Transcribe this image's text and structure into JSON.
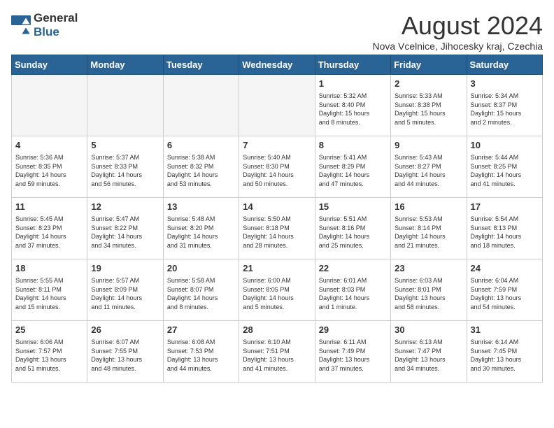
{
  "header": {
    "logo_general": "General",
    "logo_blue": "Blue",
    "title": "August 2024",
    "subtitle": "Nova Vcelnice, Jihocesky kraj, Czechia"
  },
  "weekdays": [
    "Sunday",
    "Monday",
    "Tuesday",
    "Wednesday",
    "Thursday",
    "Friday",
    "Saturday"
  ],
  "weeks": [
    [
      {
        "num": "",
        "info": ""
      },
      {
        "num": "",
        "info": ""
      },
      {
        "num": "",
        "info": ""
      },
      {
        "num": "",
        "info": ""
      },
      {
        "num": "1",
        "info": "Sunrise: 5:32 AM\nSunset: 8:40 PM\nDaylight: 15 hours\nand 8 minutes."
      },
      {
        "num": "2",
        "info": "Sunrise: 5:33 AM\nSunset: 8:38 PM\nDaylight: 15 hours\nand 5 minutes."
      },
      {
        "num": "3",
        "info": "Sunrise: 5:34 AM\nSunset: 8:37 PM\nDaylight: 15 hours\nand 2 minutes."
      }
    ],
    [
      {
        "num": "4",
        "info": "Sunrise: 5:36 AM\nSunset: 8:35 PM\nDaylight: 14 hours\nand 59 minutes."
      },
      {
        "num": "5",
        "info": "Sunrise: 5:37 AM\nSunset: 8:33 PM\nDaylight: 14 hours\nand 56 minutes."
      },
      {
        "num": "6",
        "info": "Sunrise: 5:38 AM\nSunset: 8:32 PM\nDaylight: 14 hours\nand 53 minutes."
      },
      {
        "num": "7",
        "info": "Sunrise: 5:40 AM\nSunset: 8:30 PM\nDaylight: 14 hours\nand 50 minutes."
      },
      {
        "num": "8",
        "info": "Sunrise: 5:41 AM\nSunset: 8:29 PM\nDaylight: 14 hours\nand 47 minutes."
      },
      {
        "num": "9",
        "info": "Sunrise: 5:43 AM\nSunset: 8:27 PM\nDaylight: 14 hours\nand 44 minutes."
      },
      {
        "num": "10",
        "info": "Sunrise: 5:44 AM\nSunset: 8:25 PM\nDaylight: 14 hours\nand 41 minutes."
      }
    ],
    [
      {
        "num": "11",
        "info": "Sunrise: 5:45 AM\nSunset: 8:23 PM\nDaylight: 14 hours\nand 37 minutes."
      },
      {
        "num": "12",
        "info": "Sunrise: 5:47 AM\nSunset: 8:22 PM\nDaylight: 14 hours\nand 34 minutes."
      },
      {
        "num": "13",
        "info": "Sunrise: 5:48 AM\nSunset: 8:20 PM\nDaylight: 14 hours\nand 31 minutes."
      },
      {
        "num": "14",
        "info": "Sunrise: 5:50 AM\nSunset: 8:18 PM\nDaylight: 14 hours\nand 28 minutes."
      },
      {
        "num": "15",
        "info": "Sunrise: 5:51 AM\nSunset: 8:16 PM\nDaylight: 14 hours\nand 25 minutes."
      },
      {
        "num": "16",
        "info": "Sunrise: 5:53 AM\nSunset: 8:14 PM\nDaylight: 14 hours\nand 21 minutes."
      },
      {
        "num": "17",
        "info": "Sunrise: 5:54 AM\nSunset: 8:13 PM\nDaylight: 14 hours\nand 18 minutes."
      }
    ],
    [
      {
        "num": "18",
        "info": "Sunrise: 5:55 AM\nSunset: 8:11 PM\nDaylight: 14 hours\nand 15 minutes."
      },
      {
        "num": "19",
        "info": "Sunrise: 5:57 AM\nSunset: 8:09 PM\nDaylight: 14 hours\nand 11 minutes."
      },
      {
        "num": "20",
        "info": "Sunrise: 5:58 AM\nSunset: 8:07 PM\nDaylight: 14 hours\nand 8 minutes."
      },
      {
        "num": "21",
        "info": "Sunrise: 6:00 AM\nSunset: 8:05 PM\nDaylight: 14 hours\nand 5 minutes."
      },
      {
        "num": "22",
        "info": "Sunrise: 6:01 AM\nSunset: 8:03 PM\nDaylight: 14 hours\nand 1 minute."
      },
      {
        "num": "23",
        "info": "Sunrise: 6:03 AM\nSunset: 8:01 PM\nDaylight: 13 hours\nand 58 minutes."
      },
      {
        "num": "24",
        "info": "Sunrise: 6:04 AM\nSunset: 7:59 PM\nDaylight: 13 hours\nand 54 minutes."
      }
    ],
    [
      {
        "num": "25",
        "info": "Sunrise: 6:06 AM\nSunset: 7:57 PM\nDaylight: 13 hours\nand 51 minutes."
      },
      {
        "num": "26",
        "info": "Sunrise: 6:07 AM\nSunset: 7:55 PM\nDaylight: 13 hours\nand 48 minutes."
      },
      {
        "num": "27",
        "info": "Sunrise: 6:08 AM\nSunset: 7:53 PM\nDaylight: 13 hours\nand 44 minutes."
      },
      {
        "num": "28",
        "info": "Sunrise: 6:10 AM\nSunset: 7:51 PM\nDaylight: 13 hours\nand 41 minutes."
      },
      {
        "num": "29",
        "info": "Sunrise: 6:11 AM\nSunset: 7:49 PM\nDaylight: 13 hours\nand 37 minutes."
      },
      {
        "num": "30",
        "info": "Sunrise: 6:13 AM\nSunset: 7:47 PM\nDaylight: 13 hours\nand 34 minutes."
      },
      {
        "num": "31",
        "info": "Sunrise: 6:14 AM\nSunset: 7:45 PM\nDaylight: 13 hours\nand 30 minutes."
      }
    ]
  ]
}
